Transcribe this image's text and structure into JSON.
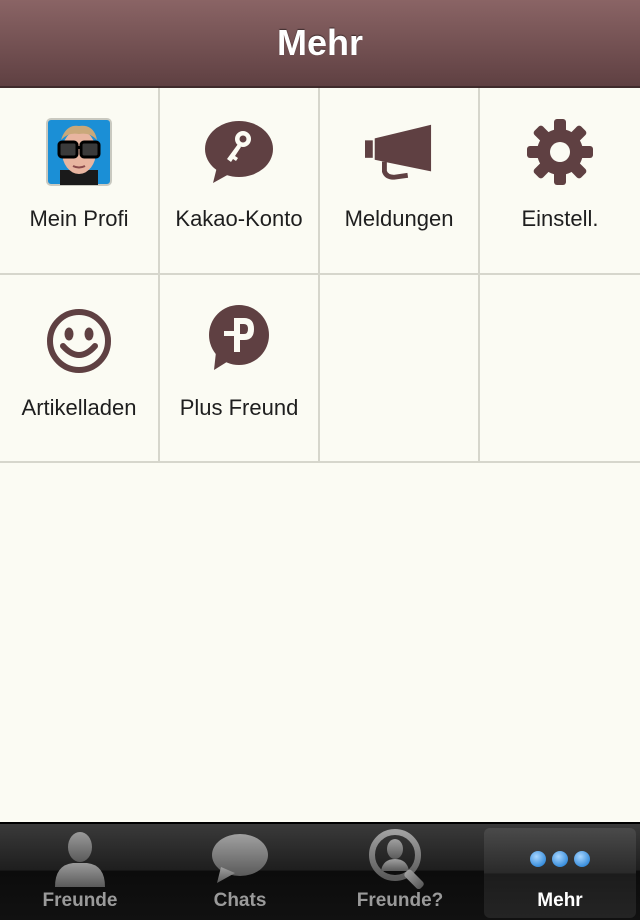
{
  "navbar": {
    "title": "Mehr"
  },
  "grid": {
    "items": [
      {
        "label": "Mein Profi",
        "icon": "profile-avatar"
      },
      {
        "label": "Kakao-Konto",
        "icon": "key-bubble-icon"
      },
      {
        "label": "Meldungen",
        "icon": "megaphone-icon"
      },
      {
        "label": "Einstell.",
        "icon": "gear-icon"
      },
      {
        "label": "Artikelladen",
        "icon": "smiley-icon"
      },
      {
        "label": "Plus Freund",
        "icon": "plus-friend-icon"
      }
    ]
  },
  "tabbar": {
    "tabs": [
      {
        "label": "Freunde",
        "icon": "person-icon",
        "active": false
      },
      {
        "label": "Chats",
        "icon": "chat-bubble-icon",
        "active": false
      },
      {
        "label": "Freunde?",
        "icon": "search-person-icon",
        "active": false
      },
      {
        "label": "Mehr",
        "icon": "more-dots-icon",
        "active": true
      }
    ]
  },
  "colors": {
    "navbar": "#6e4f50",
    "icon": "#5f4042",
    "background": "#fbfbf3",
    "active_dot": "#4da3e8"
  }
}
